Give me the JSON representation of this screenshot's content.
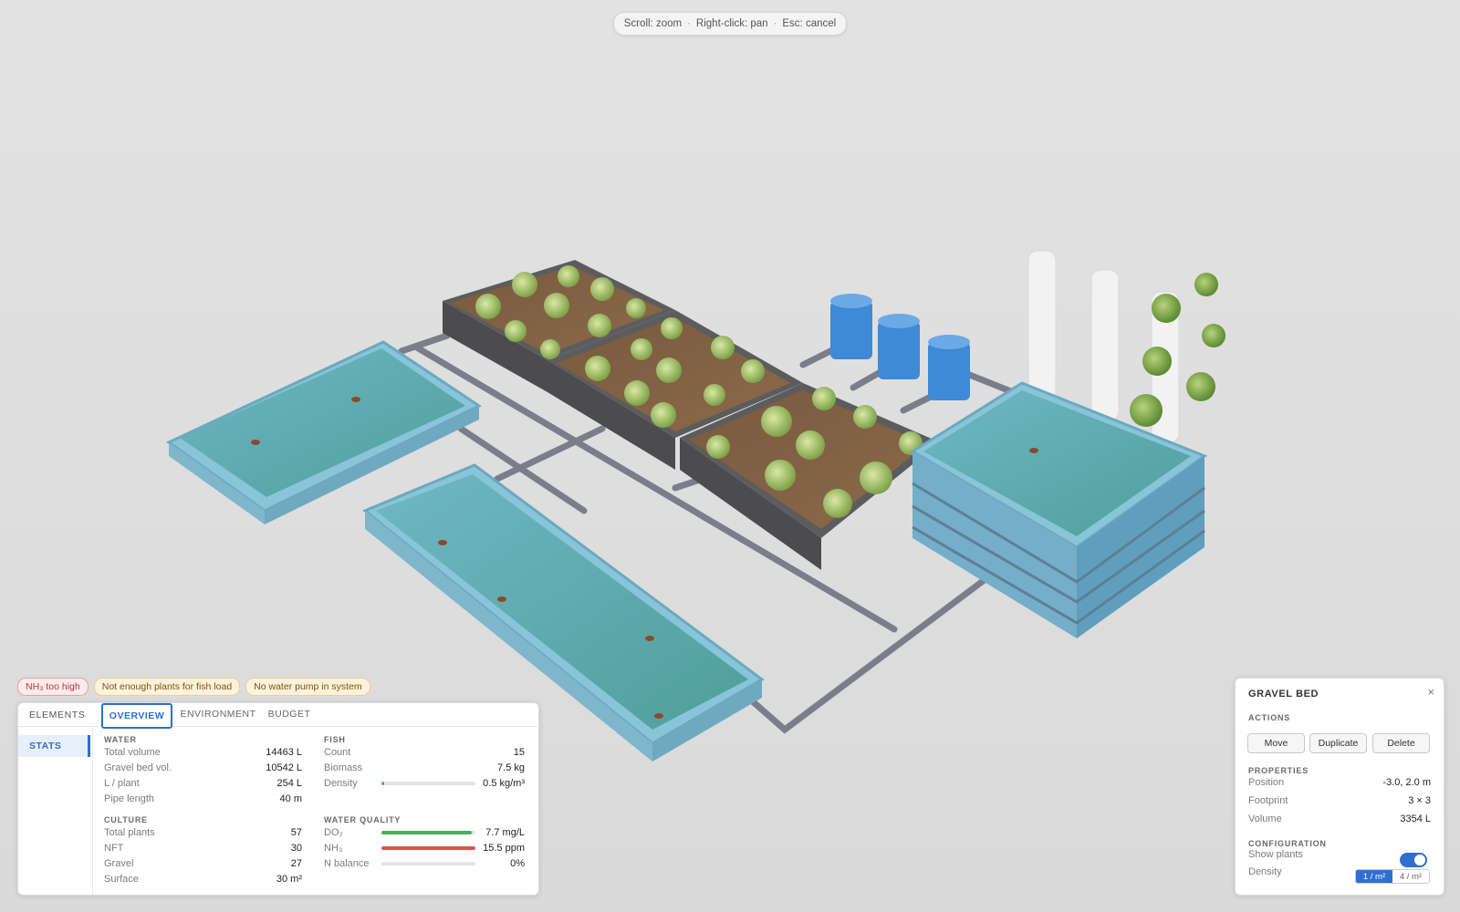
{
  "hint": {
    "scroll": "Scroll: zoom",
    "pan": "Right-click: pan",
    "esc": "Esc: cancel",
    "sep": "·"
  },
  "warnings": [
    {
      "text": "NH₃ too high",
      "level": "error"
    },
    {
      "text": "Not enough plants for fish load",
      "level": "warning"
    },
    {
      "text": "No water pump in system",
      "level": "warning"
    }
  ],
  "panel": {
    "elements_label": "ELEMENTS",
    "tabs": [
      "OVERVIEW",
      "ENVIRONMENT",
      "BUDGET"
    ],
    "active_tab": "OVERVIEW",
    "side_item": "STATS",
    "water": {
      "title": "WATER",
      "rows": [
        {
          "k": "Total volume",
          "v": "14463 L"
        },
        {
          "k": "Gravel bed vol.",
          "v": "10542 L"
        },
        {
          "k": "L / plant",
          "v": "254 L"
        },
        {
          "k": "Pipe length",
          "v": "40 m"
        }
      ]
    },
    "culture": {
      "title": "CULTURE",
      "rows": [
        {
          "k": "Total plants",
          "v": "57"
        },
        {
          "k": "NFT",
          "v": "30"
        },
        {
          "k": "Gravel",
          "v": "27"
        },
        {
          "k": "Surface",
          "v": "30 m²"
        }
      ]
    },
    "fish": {
      "title": "FISH",
      "count_label": "Count",
      "count": "15",
      "biomass_label": "Biomass",
      "biomass": "7.5 kg",
      "density_label": "Density",
      "density": "0.5 kg/m³",
      "density_level": 0.03
    },
    "quality": {
      "title": "WATER QUALITY",
      "rows": [
        {
          "k": "DO₂",
          "v": "7.7 mg/L",
          "level": 0.96,
          "color": "#4cae5b"
        },
        {
          "k": "NH₃",
          "v": "15.5 ppm",
          "level": 1.0,
          "color": "#d9534a"
        },
        {
          "k": "N balance",
          "v": "0%",
          "level": 0.0,
          "color": "#bdbdbd"
        }
      ]
    }
  },
  "props": {
    "title": "GRAVEL BED",
    "close": "×",
    "actions_title": "ACTIONS",
    "actions": [
      "Move",
      "Duplicate",
      "Delete"
    ],
    "properties_title": "PROPERTIES",
    "properties": [
      {
        "k": "Position",
        "v": "-3.0, 2.0 m"
      },
      {
        "k": "Footprint",
        "v": "3 × 3"
      },
      {
        "k": "Volume",
        "v": "3354 L"
      }
    ],
    "config_title": "CONFIGURATION",
    "show_plants_label": "Show plants",
    "show_plants": true,
    "density_label": "Density",
    "density_options": [
      "1 / m²",
      "4 / m²"
    ],
    "density_selected": "1 / m²"
  }
}
